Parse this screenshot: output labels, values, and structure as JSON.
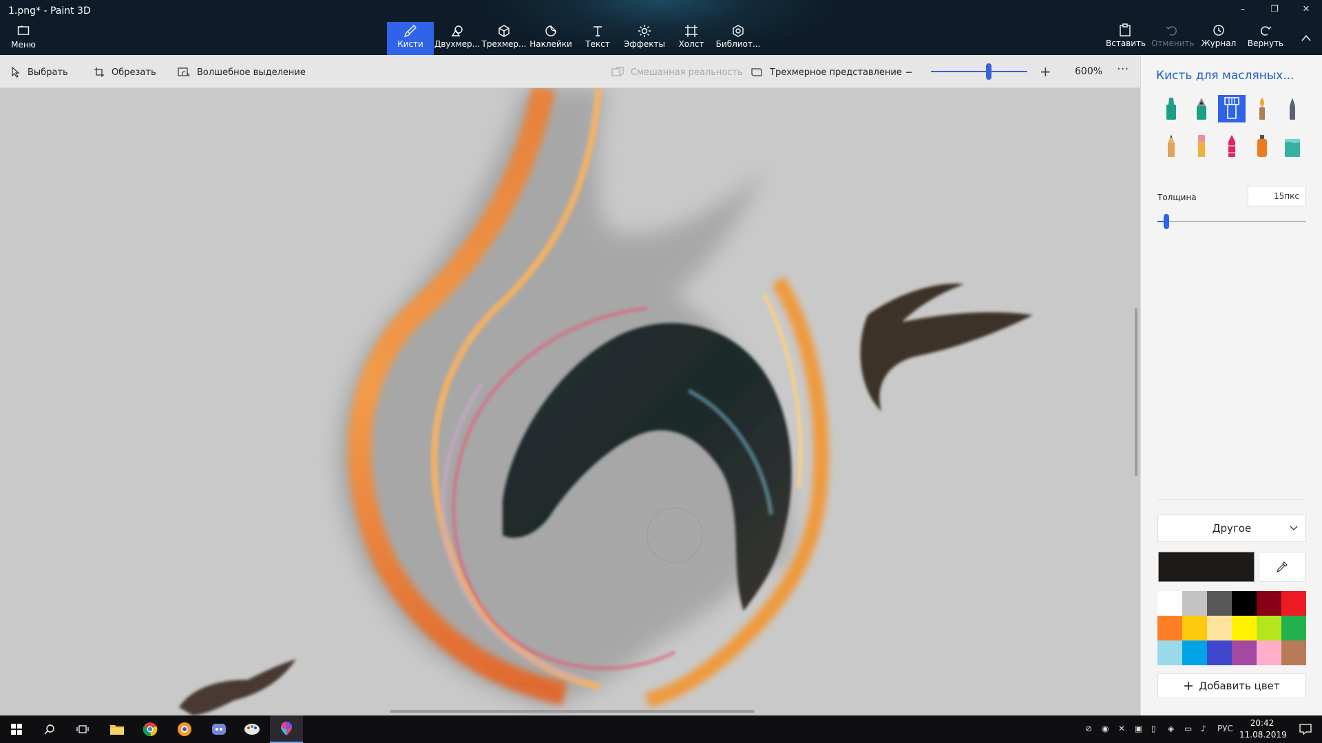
{
  "window": {
    "title": "1.png* - Paint 3D",
    "controls": {
      "minimize": "–",
      "restore": "❐",
      "close": "✕"
    }
  },
  "topbar": {
    "menu_label": "Меню",
    "tabs": [
      {
        "label": "Кисти",
        "icon": "brush-icon",
        "active": true
      },
      {
        "label": "Двухмер...",
        "icon": "2d-shapes-icon"
      },
      {
        "label": "Трехмер...",
        "icon": "3d-shapes-icon"
      },
      {
        "label": "Наклейки",
        "icon": "stickers-icon"
      },
      {
        "label": "Текст",
        "icon": "text-icon"
      },
      {
        "label": "Эффекты",
        "icon": "effects-icon"
      },
      {
        "label": "Холст",
        "icon": "canvas-icon"
      },
      {
        "label": "Библиот...",
        "icon": "library-icon"
      }
    ],
    "actions": {
      "paste": "Вставить",
      "undo": "Отменить",
      "history": "Журнал",
      "redo": "Вернуть"
    }
  },
  "subbar": {
    "select": "Выбрать",
    "crop": "Обрезать",
    "magic_select": "Волшебное выделение",
    "mixed_reality": "Смешанная реальность",
    "view_3d": "Трехмерное представление",
    "zoom": {
      "value": "600%",
      "level_fraction": 0.6
    },
    "more": "···"
  },
  "panel": {
    "title": "Кисть для масляных...",
    "brushes": [
      {
        "name": "marker",
        "color": "#1aa084"
      },
      {
        "name": "calligraphy-pen",
        "color": "#1aa084"
      },
      {
        "name": "oil-brush",
        "color": "#ffffff",
        "selected": true
      },
      {
        "name": "watercolor",
        "color": "#f4a23a"
      },
      {
        "name": "pixel-pen",
        "color": "#5a6170"
      },
      {
        "name": "pencil",
        "color": "#e7b272"
      },
      {
        "name": "eraser",
        "color": "#f08ba8"
      },
      {
        "name": "crayon",
        "color": "#e2245a"
      },
      {
        "name": "spray-can",
        "color": "#f07a1e"
      },
      {
        "name": "fill",
        "color": "#35b1a3"
      }
    ],
    "thickness": {
      "label": "Толщина",
      "value": "15пкс",
      "fraction": 0.06
    },
    "color_mode": "Другое",
    "current_color": "#1e1a17",
    "palette": [
      "#ffffff",
      "#c3c3c3",
      "#585858",
      "#000000",
      "#880015",
      "#ed1c24",
      "#ff7f27",
      "#ffc90e",
      "#fde49c",
      "#fff200",
      "#b5e61d",
      "#22b14c",
      "#99d9ea",
      "#00a2e8",
      "#3f48cc",
      "#a349a4",
      "#ffaec9",
      "#b97a57"
    ],
    "add_color": "Добавить цвет"
  },
  "taskbar": {
    "tray_lang": "РУС",
    "time": "20:42",
    "date": "11.08.2019"
  },
  "colors": {
    "accent": "#2f64e8",
    "title_blue": "#1f5fc4"
  }
}
